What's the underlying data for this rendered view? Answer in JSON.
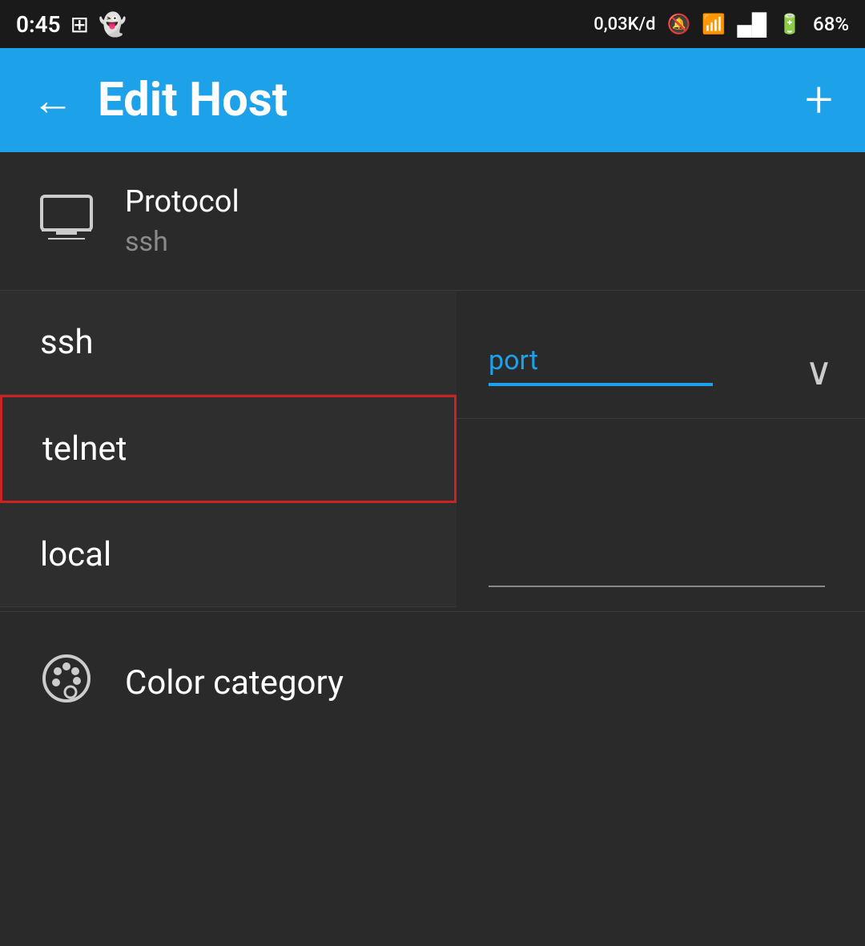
{
  "statusBar": {
    "time": "0:45",
    "dataSpeed": "0,03K/d",
    "battery": "68%",
    "icons": [
      "bbm-icon",
      "ghost-icon",
      "mute-icon",
      "wifi-icon",
      "signal-icon",
      "battery-icon"
    ]
  },
  "appBar": {
    "title": "Edit Host",
    "backLabel": "←",
    "addLabel": "+"
  },
  "protocol": {
    "label": "Protocol",
    "value": "ssh"
  },
  "dropdown": {
    "items": [
      "ssh",
      "telnet",
      "local"
    ],
    "selectedItem": "telnet"
  },
  "port": {
    "label": "port",
    "underlineColor": "#1da1e8"
  },
  "colorCategory": {
    "label": "Color category"
  }
}
